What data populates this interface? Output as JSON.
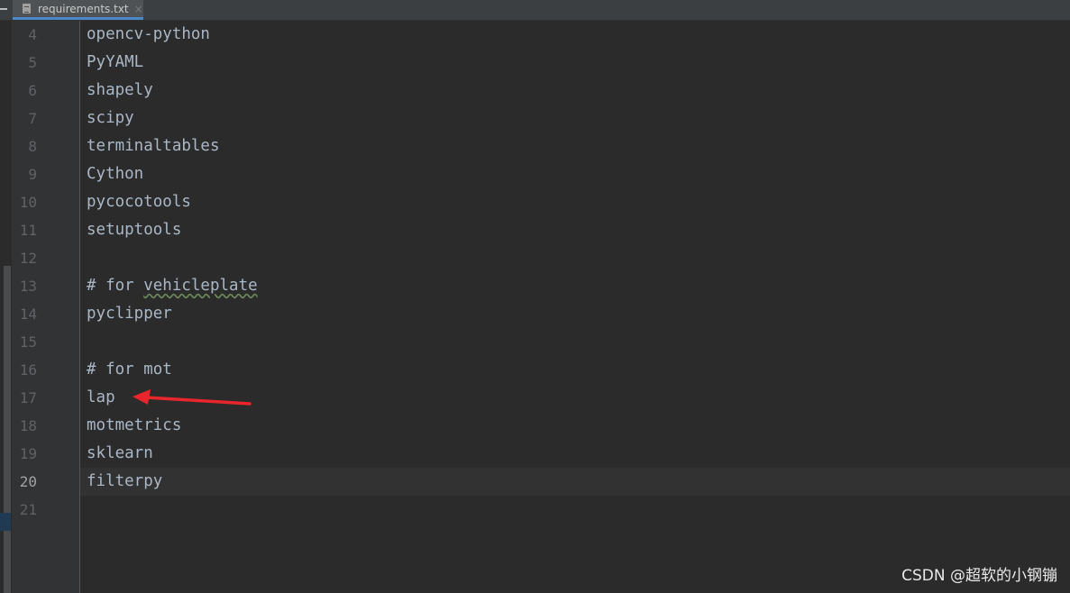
{
  "tab": {
    "label": "requirements.txt",
    "close": "×",
    "icon": "text-file-icon"
  },
  "current_line": 20,
  "lines": [
    {
      "n": "4",
      "text": "opencv-python"
    },
    {
      "n": "5",
      "text": "PyYAML"
    },
    {
      "n": "6",
      "text": "shapely"
    },
    {
      "n": "7",
      "text": "scipy"
    },
    {
      "n": "8",
      "text": "terminaltables"
    },
    {
      "n": "9",
      "text": "Cython"
    },
    {
      "n": "10",
      "text": "pycocotools"
    },
    {
      "n": "11",
      "text": "setuptools"
    },
    {
      "n": "12",
      "text": ""
    },
    {
      "n": "13",
      "text": "# for ",
      "typo": "vehicleplate"
    },
    {
      "n": "14",
      "text": "pyclipper"
    },
    {
      "n": "15",
      "text": ""
    },
    {
      "n": "16",
      "text": "# for mot"
    },
    {
      "n": "17",
      "text": "lap"
    },
    {
      "n": "18",
      "text": "motmetrics"
    },
    {
      "n": "19",
      "text": "sklearn"
    },
    {
      "n": "20",
      "text": "filterpy"
    },
    {
      "n": "21",
      "text": ""
    }
  ],
  "annotation": {
    "type": "red-arrow",
    "points_to_line": "17",
    "color": "#e8262b"
  },
  "watermark": "CSDN @超软的小钢镚"
}
